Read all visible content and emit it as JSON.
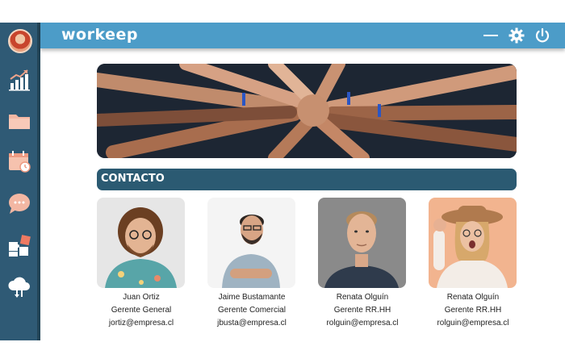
{
  "app": {
    "logo": "workeep",
    "colors": {
      "sidebar": "#2f5a75",
      "header": "#4c9cc8",
      "section_bar": "#2b5a72"
    }
  },
  "sidebar": {
    "items": [
      {
        "icon": "chart-growth-icon"
      },
      {
        "icon": "folder-icon"
      },
      {
        "icon": "calendar-clock-icon"
      },
      {
        "icon": "chat-bubble-icon"
      },
      {
        "icon": "puzzle-icon"
      },
      {
        "icon": "cloud-sync-icon"
      }
    ]
  },
  "header": {
    "buttons": [
      "minimize-icon",
      "gear-icon",
      "power-icon"
    ]
  },
  "main": {
    "section_title": "CONTACTO",
    "contacts": [
      {
        "name": "Juan Ortiz",
        "role": "Gerente General",
        "email": "jortiz@empresa.cl"
      },
      {
        "name": "Jaime Bustamante",
        "role": "Gerente Comercial",
        "email": "jbusta@empresa.cl"
      },
      {
        "name": "Renata Olguín",
        "role": "Gerente RR.HH",
        "email": "rolguin@empresa.cl"
      },
      {
        "name": "Renata Olguín",
        "role": "Gerente RR.HH",
        "email": "rolguin@empresa.cl"
      }
    ]
  }
}
